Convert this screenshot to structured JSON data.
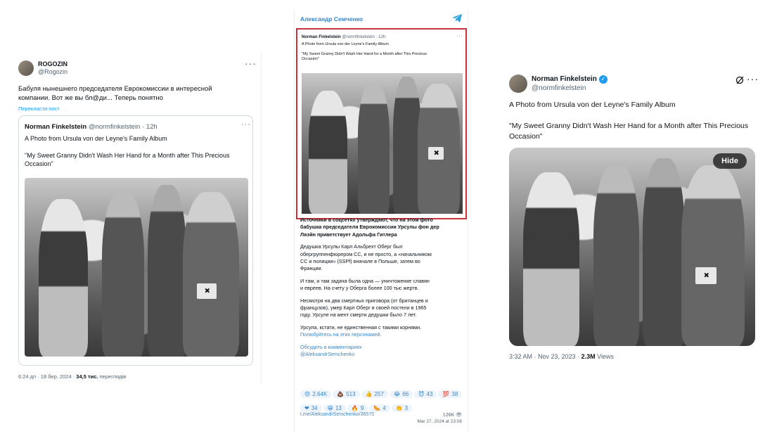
{
  "left": {
    "author_name": "ROGOZIN",
    "author_handle": "@Rogozin",
    "body_line1": "Бабуля нынешнего председателя Еврокомиссии в интересной",
    "body_line2": "компании. Вот же вы бл@ди... Теперь понятно",
    "translate_link": "Перекласти пост",
    "quoted": {
      "name": "Norman Finkelstein",
      "handle": "@normfinkelstein",
      "dot": "·",
      "time": "12h",
      "line1": "A Photo from Ursula von der Leyne's Family Album",
      "line2": "\"My Sweet Granny Didn't Wash Her Hand for a Month after This Precious",
      "line3": "Occasion\""
    },
    "footer_time": "6:24 дп · 18 бер. 2024 ·",
    "footer_views": "34,5 тис.",
    "footer_views_label": "переглядів",
    "more_icon": "more-icon"
  },
  "middle": {
    "channel_name": "Александр Семченко",
    "quoted": {
      "name": "Norman Finkelstein",
      "handle": "@normfinkelstein · 12h",
      "line1": "A Photo from Ursula von der Leyne's Family Album",
      "line2": "\"My Sweet Granny Didn't Wash Her Hand for a Month after This Precious",
      "line3": "Occasion\""
    },
    "bold_p1": "Источники в соцсетях утверждают, что на этом фото",
    "bold_p2": "бабушка председателя Еврокомиссии Урсулы фон дер",
    "bold_p3": "Ляэйн приветствует Адольфа Гитлера",
    "p2_l1": "Дедушка Урсулы Карл Альбрехт Оберг был",
    "p2_l2": "обергруппенфюрером СС, и не просто, а «начальником",
    "p2_l3": "СС и полиции» (SSPf) вначале в Польше, затем во",
    "p2_l4": "Франции.",
    "p3_l1": "И там, и там задача была одна — уничтожение славян",
    "p3_l2": "и евреев. На счету у Оберга более 100 тыс жертв.",
    "p4_l1": "Несмотря на два смертных приговора (от британцев и",
    "p4_l2": "французов), умер Карл Оберг в своей постели в 1965",
    "p4_l3": "году. Урсуле на мент смерти дедушки было 7 лет.",
    "p5_l1": "Урсула, кстати, не единственная с такими корнями.",
    "p5_link": "Полюбуйтесь на этих персонажей.",
    "discuss": "Обсудить в комментариях",
    "handle_link": "@AleksandrSemchenko",
    "reactions_row1": [
      {
        "emoji": "😡",
        "count": "2.64K"
      },
      {
        "emoji": "💩",
        "count": "513"
      },
      {
        "emoji": "👍",
        "count": "257"
      },
      {
        "emoji": "😂",
        "count": "66"
      },
      {
        "emoji": "😈",
        "count": "43"
      },
      {
        "emoji": "💯",
        "count": "38"
      }
    ],
    "reactions_row2": [
      {
        "emoji": "❤",
        "count": "34"
      },
      {
        "emoji": "😁",
        "count": "13"
      },
      {
        "emoji": "🔥",
        "count": "9"
      },
      {
        "emoji": "🌭",
        "count": "4"
      },
      {
        "emoji": "👏",
        "count": "3"
      }
    ],
    "post_link": "t.me/AleksandrSemchenko/36575",
    "views": "126K",
    "date": "Mar 27, 2024 at 23:08"
  },
  "right": {
    "name": "Norman Finkelstein",
    "handle": "@normfinkelstein",
    "line1": "A Photo from Ursula von der Leyne's Family Album",
    "line2": "\"My Sweet Granny Didn't Wash Her Hand for a Month after This Precious",
    "line3": "Occasion\"",
    "hide_label": "Hide",
    "footer_time": "3:32 AM · Nov 23, 2023 ·",
    "footer_views": "2.3M",
    "footer_views_label": "Views"
  }
}
